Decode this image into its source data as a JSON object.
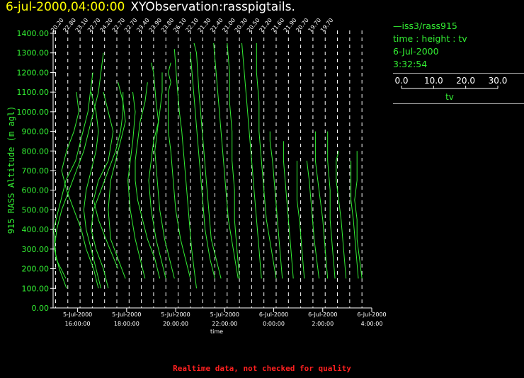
{
  "header": {
    "date": "6-jul-2000,04:00:00",
    "title": "XYObservation:rasspigtails."
  },
  "legend": {
    "series_label": "iss3/rass915",
    "desc": "time : height : tv",
    "date": "6-Jul-2000",
    "time": "3:32:54",
    "scale_ticks": [
      "0.0",
      "10.0",
      "20.0",
      "30.0"
    ],
    "scale_values": [
      0,
      10,
      20,
      30
    ],
    "scale_label": "tv"
  },
  "footer": {
    "note": "Realtime data, not checked for quality"
  },
  "colors": {
    "data": "#33ee33",
    "axis": "#ffffff",
    "title_date": "#ffff00",
    "note": "#ff2020"
  },
  "chart_data": {
    "type": "line",
    "ylabel": "915 RASS Altitude (m agl)",
    "xlabel": "time",
    "ylim": [
      0,
      1400
    ],
    "xlim_hours": [
      15,
      28
    ],
    "yticks": [
      "0.00",
      "100.00",
      "200.00",
      "300.00",
      "400.00",
      "500.00",
      "600.00",
      "700.00",
      "800.00",
      "900.00",
      "1000.00",
      "1100.00",
      "1200.00",
      "1300.00",
      "1400.00"
    ],
    "ytick_values": [
      0,
      100,
      200,
      300,
      400,
      500,
      600,
      700,
      800,
      900,
      1000,
      1100,
      1200,
      1300,
      1400
    ],
    "xticks": [
      {
        "hour": 16,
        "date": "5-Jul-2000",
        "time": "16:00:00"
      },
      {
        "hour": 18,
        "date": "5-Jul-2000",
        "time": "18:00:00"
      },
      {
        "hour": 20,
        "date": "5-Jul-2000",
        "time": "20:00:00"
      },
      {
        "hour": 22,
        "date": "5-Jul-2000",
        "time": "22:00:00"
      },
      {
        "hour": 24,
        "date": "6-Jul-2000",
        "time": "0:00:00"
      },
      {
        "hour": 26,
        "date": "6-Jul-2000",
        "time": "2:00:00"
      },
      {
        "hour": 28,
        "date": "6-Jul-2000",
        "time": "4:00:00"
      }
    ],
    "profile_hours": [
      15.1,
      15.6,
      16.1,
      16.6,
      17.1,
      17.6,
      18.1,
      18.6,
      19.1,
      19.6,
      20.1,
      20.6,
      21.1,
      21.6,
      22.1,
      22.6,
      23.1,
      23.6,
      24.1,
      24.6,
      25.1,
      25.6,
      26.1,
      26.6,
      27.1,
      27.6
    ],
    "profile_labels": [
      "20.20",
      "22.80",
      "23.10",
      "22.70",
      "24.20",
      "22.70",
      "22.70",
      "23.40",
      "23.90",
      "23.80",
      "26.10",
      "22.10",
      "21.30",
      "21.40",
      "21.00",
      "20.30",
      "20.50",
      "21.20",
      "21.60",
      "21.90",
      "20.70",
      "19.70",
      "19.70",
      "",
      "",
      ""
    ],
    "hours_per_tv_unit": 0.1,
    "profiles": [
      {
        "start": 15.05,
        "points": [
          [
            5,
            100
          ],
          [
            2,
            200
          ],
          [
            0,
            300
          ],
          [
            1,
            400
          ],
          [
            3,
            500
          ],
          [
            6,
            600
          ],
          [
            9,
            700
          ],
          [
            12,
            800
          ],
          [
            14,
            900
          ],
          [
            16,
            1000
          ],
          [
            18,
            1100
          ],
          [
            19,
            1200
          ],
          [
            20,
            1300
          ]
        ]
      },
      {
        "start": 15.12,
        "points": [
          [
            4,
            150
          ],
          [
            0,
            250
          ],
          [
            -1,
            400
          ],
          [
            1,
            500
          ],
          [
            4,
            650
          ],
          [
            8,
            750
          ],
          [
            11,
            900
          ],
          [
            13,
            1000
          ],
          [
            14,
            1100
          ],
          [
            15,
            1200
          ]
        ]
      },
      {
        "start": 15.45,
        "points": [
          [
            14,
            100
          ],
          [
            12,
            200
          ],
          [
            9,
            300
          ],
          [
            7,
            400
          ],
          [
            4,
            500
          ],
          [
            1,
            600
          ],
          [
            -1,
            700
          ],
          [
            1,
            800
          ],
          [
            4,
            900
          ],
          [
            6,
            1000
          ],
          [
            5,
            1100
          ]
        ]
      },
      {
        "start": 15.75,
        "points": [
          [
            12,
            100
          ],
          [
            10,
            200
          ],
          [
            8,
            300
          ],
          [
            6,
            400
          ],
          [
            5,
            500
          ],
          [
            6,
            600
          ],
          [
            8,
            700
          ],
          [
            10,
            800
          ],
          [
            11,
            900
          ],
          [
            10,
            1000
          ],
          [
            8,
            1100
          ]
        ]
      },
      {
        "start": 16.45,
        "points": [
          [
            8,
            100
          ],
          [
            6,
            200
          ],
          [
            3,
            300
          ],
          [
            1,
            400
          ],
          [
            2,
            500
          ],
          [
            5,
            600
          ],
          [
            8,
            700
          ],
          [
            11,
            800
          ],
          [
            13,
            900
          ],
          [
            14,
            1000
          ],
          [
            14,
            1100
          ]
        ]
      },
      {
        "start": 16.55,
        "points": [
          [
            11,
            200
          ],
          [
            7,
            320
          ],
          [
            3,
            450
          ],
          [
            1,
            550
          ],
          [
            3,
            650
          ],
          [
            7,
            750
          ],
          [
            9,
            900
          ],
          [
            7,
            1000
          ],
          [
            5,
            1100
          ]
        ]
      },
      {
        "start": 17.05,
        "points": [
          [
            9,
            150
          ],
          [
            6,
            250
          ],
          [
            3,
            350
          ],
          [
            2,
            500
          ],
          [
            3,
            650
          ],
          [
            5,
            750
          ],
          [
            7,
            850
          ],
          [
            9,
            950
          ],
          [
            8,
            1050
          ],
          [
            6,
            1150
          ]
        ]
      },
      {
        "start": 17.75,
        "points": [
          [
            10,
            150
          ],
          [
            8,
            250
          ],
          [
            6,
            350
          ],
          [
            4,
            500
          ],
          [
            3,
            650
          ],
          [
            4,
            750
          ],
          [
            5,
            850
          ],
          [
            6,
            1000
          ],
          [
            5,
            1100
          ]
        ]
      },
      {
        "start": 18.15,
        "points": [
          [
            12,
            150
          ],
          [
            10,
            250
          ],
          [
            7,
            350
          ],
          [
            5,
            450
          ],
          [
            3,
            550
          ],
          [
            2,
            650
          ],
          [
            2,
            750
          ],
          [
            3,
            850
          ],
          [
            4,
            950
          ],
          [
            6,
            1050
          ],
          [
            7,
            1150
          ]
        ]
      },
      {
        "start": 18.7,
        "points": [
          [
            9,
            150
          ],
          [
            7,
            250
          ],
          [
            5,
            350
          ],
          [
            3,
            500
          ],
          [
            2,
            650
          ],
          [
            3,
            750
          ],
          [
            4,
            850
          ],
          [
            6,
            950
          ],
          [
            5,
            1050
          ],
          [
            4,
            1200
          ],
          [
            3,
            1250
          ]
        ]
      },
      {
        "start": 19.15,
        "points": [
          [
            8,
            150
          ],
          [
            6,
            250
          ],
          [
            4,
            350
          ],
          [
            2,
            500
          ],
          [
            1,
            650
          ],
          [
            0,
            800
          ],
          [
            1,
            900
          ],
          [
            2,
            1000
          ],
          [
            3,
            1100
          ],
          [
            3,
            1200
          ]
        ]
      },
      {
        "start": 19.7,
        "points": [
          [
            9,
            150
          ],
          [
            7,
            250
          ],
          [
            5,
            350
          ],
          [
            3,
            500
          ],
          [
            2,
            650
          ],
          [
            1,
            800
          ],
          [
            0,
            900
          ],
          [
            0,
            1000
          ],
          [
            0,
            1100
          ],
          [
            1,
            1150
          ],
          [
            0,
            1200
          ],
          [
            1,
            1250
          ]
        ]
      },
      {
        "start": 20.05,
        "points": [
          [
            8,
            100
          ],
          [
            7,
            200
          ],
          [
            6,
            300
          ],
          [
            5,
            450
          ],
          [
            4,
            600
          ],
          [
            3,
            750
          ],
          [
            2,
            900
          ],
          [
            1,
            1000
          ],
          [
            0,
            1150
          ],
          [
            -1,
            1320
          ]
        ]
      },
      {
        "start": 20.6,
        "points": [
          [
            10,
            150
          ],
          [
            8,
            250
          ],
          [
            6,
            400
          ],
          [
            5,
            550
          ],
          [
            4,
            700
          ],
          [
            3,
            850
          ],
          [
            2,
            1000
          ],
          [
            1,
            1150
          ],
          [
            0,
            1300
          ]
        ]
      },
      {
        "start": 20.85,
        "points": [
          [
            10,
            150
          ],
          [
            8,
            250
          ],
          [
            6,
            350
          ],
          [
            5,
            500
          ],
          [
            4,
            650
          ],
          [
            3,
            800
          ],
          [
            2,
            950
          ],
          [
            1,
            1100
          ],
          [
            0,
            1300
          ],
          [
            -1,
            1350
          ]
        ]
      },
      {
        "start": 21.55,
        "points": [
          [
            10,
            150
          ],
          [
            8,
            300
          ],
          [
            6,
            450
          ],
          [
            5,
            600
          ],
          [
            4,
            750
          ],
          [
            3,
            900
          ],
          [
            2,
            1050
          ],
          [
            1,
            1200
          ],
          [
            0,
            1350
          ]
        ]
      },
      {
        "start": 22.2,
        "points": [
          [
            4,
            150
          ],
          [
            3,
            300
          ],
          [
            2,
            450
          ],
          [
            2,
            600
          ],
          [
            1,
            750
          ],
          [
            1,
            900
          ],
          [
            0,
            1050
          ],
          [
            0,
            1200
          ],
          [
            -1,
            1350
          ]
        ]
      },
      {
        "start": 22.8,
        "points": [
          [
            7,
            150
          ],
          [
            6,
            300
          ],
          [
            5,
            450
          ],
          [
            4,
            600
          ],
          [
            3,
            750
          ],
          [
            2,
            900
          ],
          [
            1,
            1050
          ],
          [
            0,
            1200
          ],
          [
            -1,
            1350
          ]
        ]
      },
      {
        "start": 23.3,
        "points": [
          [
            8,
            150
          ],
          [
            6,
            300
          ],
          [
            4,
            450
          ],
          [
            3,
            600
          ],
          [
            2,
            750
          ],
          [
            1,
            900
          ],
          [
            1,
            1050
          ],
          [
            0,
            1200
          ],
          [
            0,
            1350
          ]
        ]
      },
      {
        "start": 23.85,
        "points": [
          [
            5,
            150
          ],
          [
            4,
            300
          ],
          [
            3,
            450
          ],
          [
            2,
            600
          ],
          [
            1,
            750
          ],
          [
            0,
            850
          ],
          [
            0,
            900
          ]
        ]
      },
      {
        "start": 24.2,
        "points": [
          [
            6,
            150
          ],
          [
            5,
            300
          ],
          [
            4,
            450
          ],
          [
            3,
            600
          ],
          [
            2,
            750
          ],
          [
            2,
            850
          ]
        ]
      },
      {
        "start": 24.85,
        "points": [
          [
            4,
            150
          ],
          [
            3,
            300
          ],
          [
            2,
            450
          ],
          [
            1,
            550
          ],
          [
            1,
            650
          ],
          [
            1,
            750
          ]
        ]
      },
      {
        "start": 25.25,
        "points": [
          [
            6,
            150
          ],
          [
            5,
            250
          ],
          [
            4,
            350
          ],
          [
            3,
            500
          ],
          [
            2,
            650
          ],
          [
            1,
            750
          ]
        ]
      },
      {
        "start": 25.7,
        "points": [
          [
            5,
            150
          ],
          [
            4,
            300
          ],
          [
            3,
            450
          ],
          [
            2,
            550
          ],
          [
            1,
            650
          ],
          [
            0,
            750
          ],
          [
            0,
            850
          ],
          [
            0,
            900
          ]
        ]
      },
      {
        "start": 26.2,
        "points": [
          [
            3,
            150
          ],
          [
            2,
            300
          ],
          [
            1,
            450
          ],
          [
            1,
            600
          ],
          [
            0,
            750
          ],
          [
            0,
            850
          ],
          [
            0,
            900
          ]
        ]
      },
      {
        "start": 26.55,
        "points": [
          [
            4,
            150
          ],
          [
            3,
            300
          ],
          [
            2,
            450
          ],
          [
            1,
            550
          ],
          [
            0,
            650
          ],
          [
            0,
            750
          ],
          [
            1,
            800
          ]
        ]
      },
      {
        "start": 27.15,
        "points": [
          [
            3,
            150
          ],
          [
            2,
            300
          ],
          [
            1,
            450
          ],
          [
            0,
            550
          ],
          [
            0,
            650
          ],
          [
            0,
            750
          ]
        ]
      },
      {
        "start": 27.4,
        "points": [
          [
            2,
            150
          ],
          [
            1,
            250
          ],
          [
            0,
            350
          ],
          [
            0,
            450
          ],
          [
            -1,
            550
          ],
          [
            0,
            650
          ],
          [
            0,
            750
          ],
          [
            0,
            800
          ]
        ]
      }
    ]
  }
}
